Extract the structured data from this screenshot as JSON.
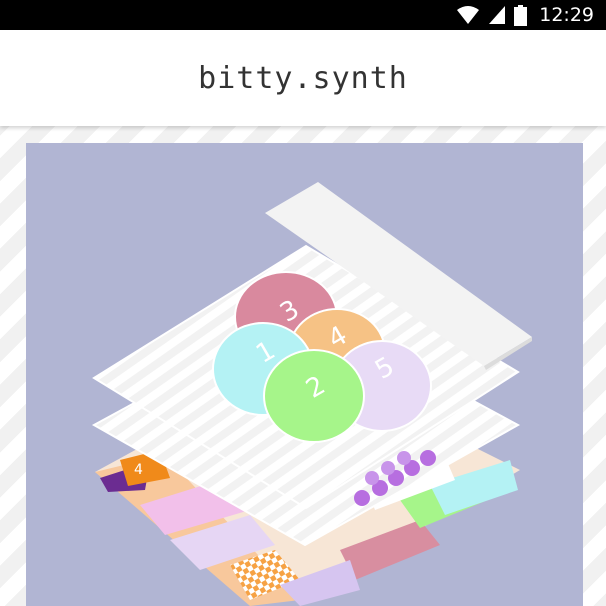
{
  "status_bar": {
    "time": "12:29",
    "icons": [
      "wifi-icon",
      "signal-icon",
      "battery-icon"
    ]
  },
  "app_bar": {
    "title": "bitty.synth"
  },
  "hero": {
    "background_color": "#b1b5d3",
    "top_layer": {
      "pads": [
        {
          "label": "3",
          "color": "#d9899e"
        },
        {
          "label": "4",
          "color": "#f6c285"
        },
        {
          "label": "1",
          "color": "#b4f2f4"
        },
        {
          "label": "5",
          "color": "#e8dbf6"
        },
        {
          "label": "2",
          "color": "#a6f58a"
        }
      ]
    },
    "bottom_layer": {
      "sequencer_label": "4"
    }
  }
}
